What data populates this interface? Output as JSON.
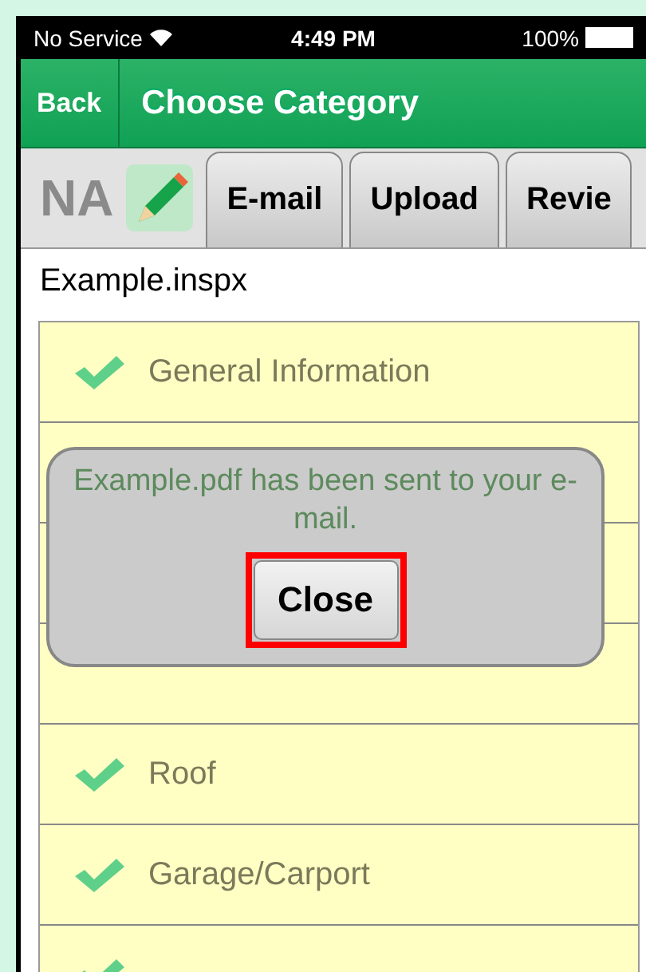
{
  "status_bar": {
    "carrier": "No Service",
    "time": "4:49 PM",
    "battery": "100%"
  },
  "nav_bar": {
    "back": "Back",
    "title": "Choose Category"
  },
  "toolbar": {
    "label": "NA",
    "buttons": [
      "E-mail",
      "Upload",
      "Revie"
    ]
  },
  "file_name": "Example.inspx",
  "rows": [
    {
      "label": "General Information",
      "checked": true
    },
    {},
    {},
    {},
    {
      "label": "Roof",
      "checked": true
    },
    {
      "label": "Garage/Carport",
      "checked": true
    },
    {
      "checked": true
    }
  ],
  "dialog": {
    "message": "Example.pdf has been sent to your e-mail.",
    "button": "Close",
    "highlighted": true
  }
}
